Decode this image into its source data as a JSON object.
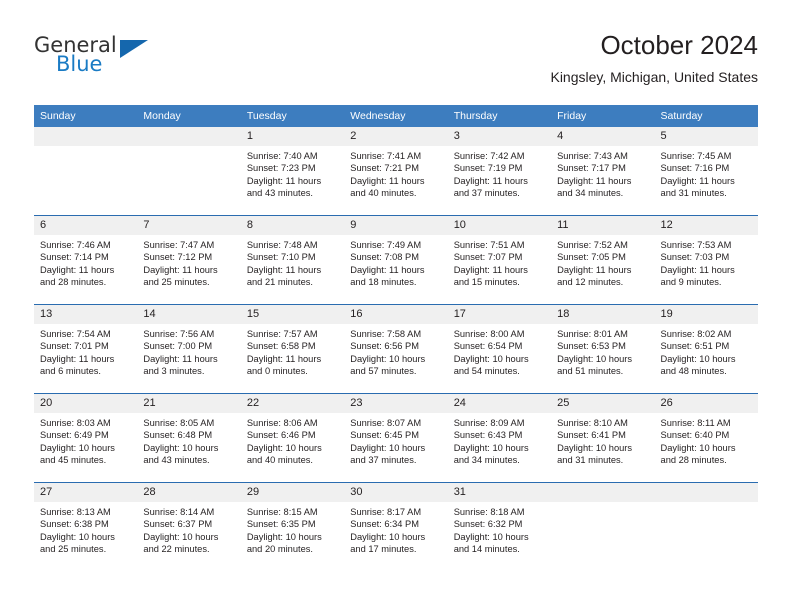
{
  "brand": {
    "name_top": "General",
    "name_bottom": "Blue",
    "triangle_color": "#1567ad",
    "blue_color": "#1a7bc4"
  },
  "header": {
    "title": "October 2024",
    "subtitle": "Kingsley, Michigan, United States"
  },
  "theme": {
    "header_bg": "#3d7dbf",
    "row_divider": "#2a6cb0",
    "daynum_bg": "#f0f0f0",
    "text": "#231f20"
  },
  "weekday_headers": [
    "Sunday",
    "Monday",
    "Tuesday",
    "Wednesday",
    "Thursday",
    "Friday",
    "Saturday"
  ],
  "weeks": [
    [
      {
        "day": "",
        "sunrise": "",
        "sunset": "",
        "daylight_line1": "",
        "daylight_line2": ""
      },
      {
        "day": "",
        "sunrise": "",
        "sunset": "",
        "daylight_line1": "",
        "daylight_line2": ""
      },
      {
        "day": "1",
        "sunrise": "Sunrise: 7:40 AM",
        "sunset": "Sunset: 7:23 PM",
        "daylight_line1": "Daylight: 11 hours",
        "daylight_line2": "and 43 minutes."
      },
      {
        "day": "2",
        "sunrise": "Sunrise: 7:41 AM",
        "sunset": "Sunset: 7:21 PM",
        "daylight_line1": "Daylight: 11 hours",
        "daylight_line2": "and 40 minutes."
      },
      {
        "day": "3",
        "sunrise": "Sunrise: 7:42 AM",
        "sunset": "Sunset: 7:19 PM",
        "daylight_line1": "Daylight: 11 hours",
        "daylight_line2": "and 37 minutes."
      },
      {
        "day": "4",
        "sunrise": "Sunrise: 7:43 AM",
        "sunset": "Sunset: 7:17 PM",
        "daylight_line1": "Daylight: 11 hours",
        "daylight_line2": "and 34 minutes."
      },
      {
        "day": "5",
        "sunrise": "Sunrise: 7:45 AM",
        "sunset": "Sunset: 7:16 PM",
        "daylight_line1": "Daylight: 11 hours",
        "daylight_line2": "and 31 minutes."
      }
    ],
    [
      {
        "day": "6",
        "sunrise": "Sunrise: 7:46 AM",
        "sunset": "Sunset: 7:14 PM",
        "daylight_line1": "Daylight: 11 hours",
        "daylight_line2": "and 28 minutes."
      },
      {
        "day": "7",
        "sunrise": "Sunrise: 7:47 AM",
        "sunset": "Sunset: 7:12 PM",
        "daylight_line1": "Daylight: 11 hours",
        "daylight_line2": "and 25 minutes."
      },
      {
        "day": "8",
        "sunrise": "Sunrise: 7:48 AM",
        "sunset": "Sunset: 7:10 PM",
        "daylight_line1": "Daylight: 11 hours",
        "daylight_line2": "and 21 minutes."
      },
      {
        "day": "9",
        "sunrise": "Sunrise: 7:49 AM",
        "sunset": "Sunset: 7:08 PM",
        "daylight_line1": "Daylight: 11 hours",
        "daylight_line2": "and 18 minutes."
      },
      {
        "day": "10",
        "sunrise": "Sunrise: 7:51 AM",
        "sunset": "Sunset: 7:07 PM",
        "daylight_line1": "Daylight: 11 hours",
        "daylight_line2": "and 15 minutes."
      },
      {
        "day": "11",
        "sunrise": "Sunrise: 7:52 AM",
        "sunset": "Sunset: 7:05 PM",
        "daylight_line1": "Daylight: 11 hours",
        "daylight_line2": "and 12 minutes."
      },
      {
        "day": "12",
        "sunrise": "Sunrise: 7:53 AM",
        "sunset": "Sunset: 7:03 PM",
        "daylight_line1": "Daylight: 11 hours",
        "daylight_line2": "and 9 minutes."
      }
    ],
    [
      {
        "day": "13",
        "sunrise": "Sunrise: 7:54 AM",
        "sunset": "Sunset: 7:01 PM",
        "daylight_line1": "Daylight: 11 hours",
        "daylight_line2": "and 6 minutes."
      },
      {
        "day": "14",
        "sunrise": "Sunrise: 7:56 AM",
        "sunset": "Sunset: 7:00 PM",
        "daylight_line1": "Daylight: 11 hours",
        "daylight_line2": "and 3 minutes."
      },
      {
        "day": "15",
        "sunrise": "Sunrise: 7:57 AM",
        "sunset": "Sunset: 6:58 PM",
        "daylight_line1": "Daylight: 11 hours",
        "daylight_line2": "and 0 minutes."
      },
      {
        "day": "16",
        "sunrise": "Sunrise: 7:58 AM",
        "sunset": "Sunset: 6:56 PM",
        "daylight_line1": "Daylight: 10 hours",
        "daylight_line2": "and 57 minutes."
      },
      {
        "day": "17",
        "sunrise": "Sunrise: 8:00 AM",
        "sunset": "Sunset: 6:54 PM",
        "daylight_line1": "Daylight: 10 hours",
        "daylight_line2": "and 54 minutes."
      },
      {
        "day": "18",
        "sunrise": "Sunrise: 8:01 AM",
        "sunset": "Sunset: 6:53 PM",
        "daylight_line1": "Daylight: 10 hours",
        "daylight_line2": "and 51 minutes."
      },
      {
        "day": "19",
        "sunrise": "Sunrise: 8:02 AM",
        "sunset": "Sunset: 6:51 PM",
        "daylight_line1": "Daylight: 10 hours",
        "daylight_line2": "and 48 minutes."
      }
    ],
    [
      {
        "day": "20",
        "sunrise": "Sunrise: 8:03 AM",
        "sunset": "Sunset: 6:49 PM",
        "daylight_line1": "Daylight: 10 hours",
        "daylight_line2": "and 45 minutes."
      },
      {
        "day": "21",
        "sunrise": "Sunrise: 8:05 AM",
        "sunset": "Sunset: 6:48 PM",
        "daylight_line1": "Daylight: 10 hours",
        "daylight_line2": "and 43 minutes."
      },
      {
        "day": "22",
        "sunrise": "Sunrise: 8:06 AM",
        "sunset": "Sunset: 6:46 PM",
        "daylight_line1": "Daylight: 10 hours",
        "daylight_line2": "and 40 minutes."
      },
      {
        "day": "23",
        "sunrise": "Sunrise: 8:07 AM",
        "sunset": "Sunset: 6:45 PM",
        "daylight_line1": "Daylight: 10 hours",
        "daylight_line2": "and 37 minutes."
      },
      {
        "day": "24",
        "sunrise": "Sunrise: 8:09 AM",
        "sunset": "Sunset: 6:43 PM",
        "daylight_line1": "Daylight: 10 hours",
        "daylight_line2": "and 34 minutes."
      },
      {
        "day": "25",
        "sunrise": "Sunrise: 8:10 AM",
        "sunset": "Sunset: 6:41 PM",
        "daylight_line1": "Daylight: 10 hours",
        "daylight_line2": "and 31 minutes."
      },
      {
        "day": "26",
        "sunrise": "Sunrise: 8:11 AM",
        "sunset": "Sunset: 6:40 PM",
        "daylight_line1": "Daylight: 10 hours",
        "daylight_line2": "and 28 minutes."
      }
    ],
    [
      {
        "day": "27",
        "sunrise": "Sunrise: 8:13 AM",
        "sunset": "Sunset: 6:38 PM",
        "daylight_line1": "Daylight: 10 hours",
        "daylight_line2": "and 25 minutes."
      },
      {
        "day": "28",
        "sunrise": "Sunrise: 8:14 AM",
        "sunset": "Sunset: 6:37 PM",
        "daylight_line1": "Daylight: 10 hours",
        "daylight_line2": "and 22 minutes."
      },
      {
        "day": "29",
        "sunrise": "Sunrise: 8:15 AM",
        "sunset": "Sunset: 6:35 PM",
        "daylight_line1": "Daylight: 10 hours",
        "daylight_line2": "and 20 minutes."
      },
      {
        "day": "30",
        "sunrise": "Sunrise: 8:17 AM",
        "sunset": "Sunset: 6:34 PM",
        "daylight_line1": "Daylight: 10 hours",
        "daylight_line2": "and 17 minutes."
      },
      {
        "day": "31",
        "sunrise": "Sunrise: 8:18 AM",
        "sunset": "Sunset: 6:32 PM",
        "daylight_line1": "Daylight: 10 hours",
        "daylight_line2": "and 14 minutes."
      },
      {
        "day": "",
        "sunrise": "",
        "sunset": "",
        "daylight_line1": "",
        "daylight_line2": ""
      },
      {
        "day": "",
        "sunrise": "",
        "sunset": "",
        "daylight_line1": "",
        "daylight_line2": ""
      }
    ]
  ]
}
